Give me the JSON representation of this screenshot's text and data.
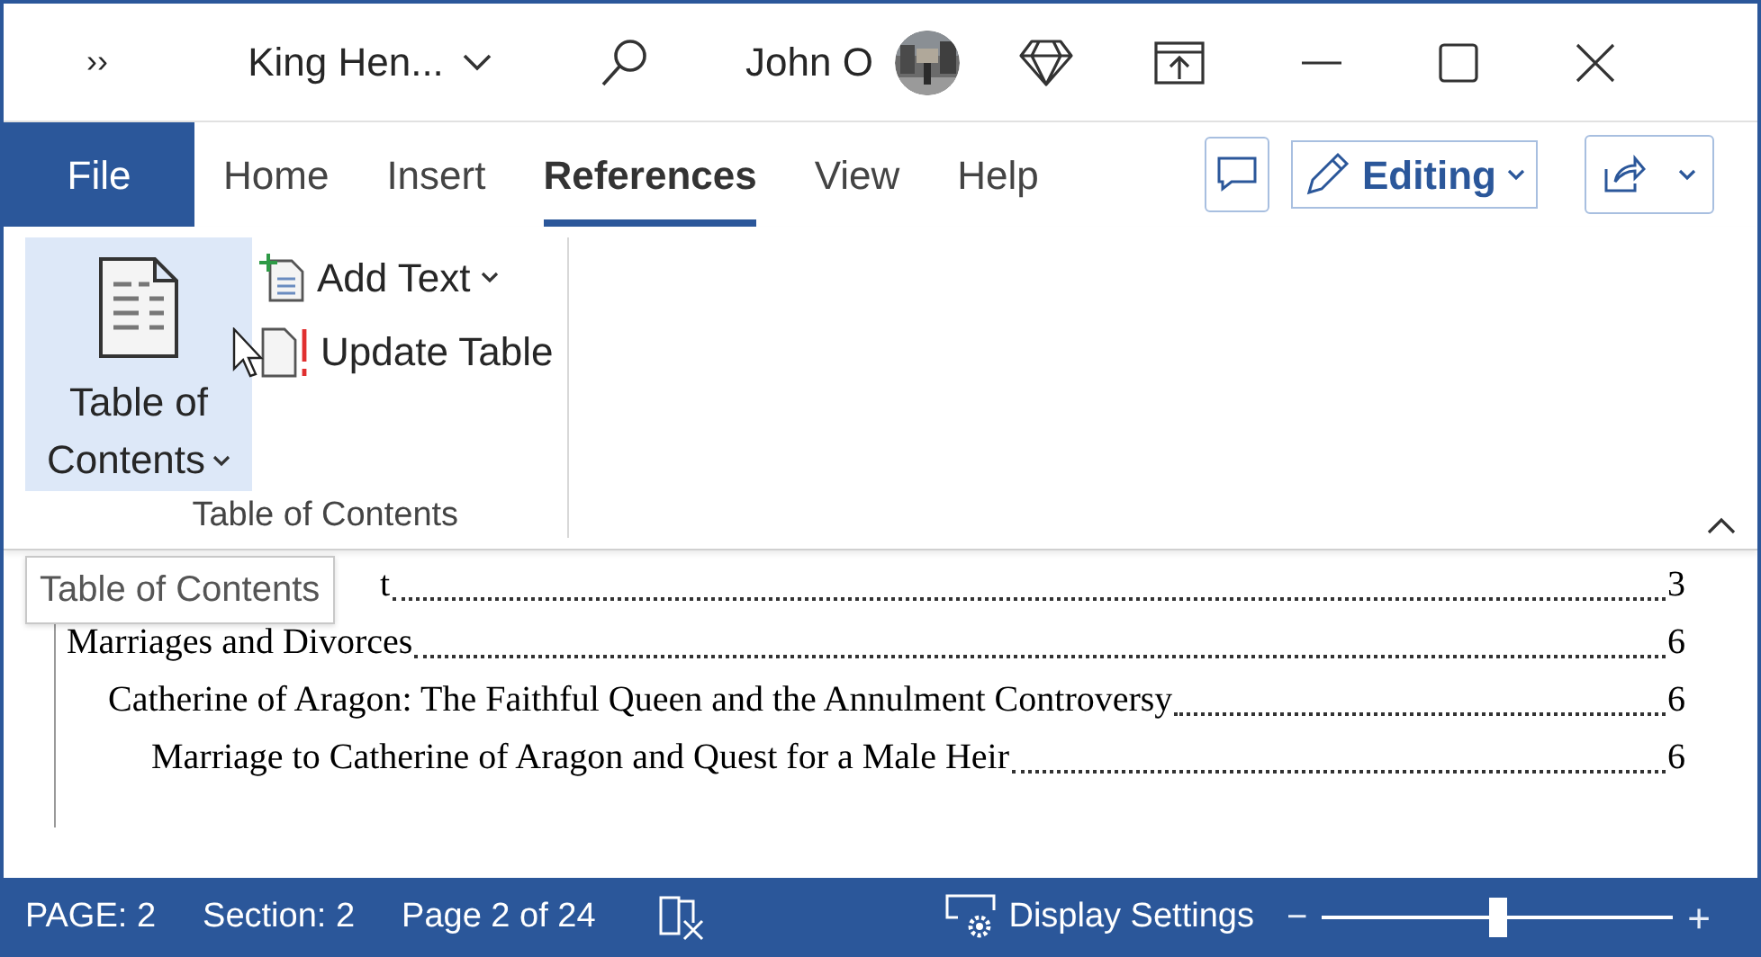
{
  "title_bar": {
    "overflow": "››",
    "document_title": "King Hen...",
    "user_name": "John O"
  },
  "tabs": [
    {
      "label": "File",
      "kind": "file",
      "selected": false
    },
    {
      "label": "Home",
      "kind": "tab",
      "selected": false
    },
    {
      "label": "Insert",
      "kind": "tab",
      "selected": false
    },
    {
      "label": "References",
      "kind": "tab",
      "selected": true
    },
    {
      "label": "View",
      "kind": "tab",
      "selected": false
    },
    {
      "label": "Help",
      "kind": "tab",
      "selected": false
    }
  ],
  "mode_button": "Editing",
  "ribbon": {
    "big_button": {
      "line1": "Table of",
      "line2": "Contents",
      "selected": true
    },
    "add_text": "Add Text",
    "update_table": "Update Table",
    "group_label": "Table of Contents"
  },
  "tooltip": "Table of Contents",
  "toc": [
    {
      "text": "t",
      "page": "3"
    },
    {
      "text": "Marriages and Divorces",
      "page": "6",
      "children": [
        {
          "text": "Catherine of Aragon: The Faithful Queen and the Annulment Controversy",
          "page": "6",
          "children": [
            {
              "text": "Marriage to Catherine of Aragon and Quest for a Male Heir",
              "page": "6"
            }
          ]
        }
      ]
    }
  ],
  "status_bar": {
    "page": "PAGE: 2",
    "section": "Section: 2",
    "page_count": "Page 2 of 24",
    "display_settings": "Display Settings",
    "zoom": {
      "minus": "−",
      "plus": "+",
      "level": 0.5
    }
  }
}
